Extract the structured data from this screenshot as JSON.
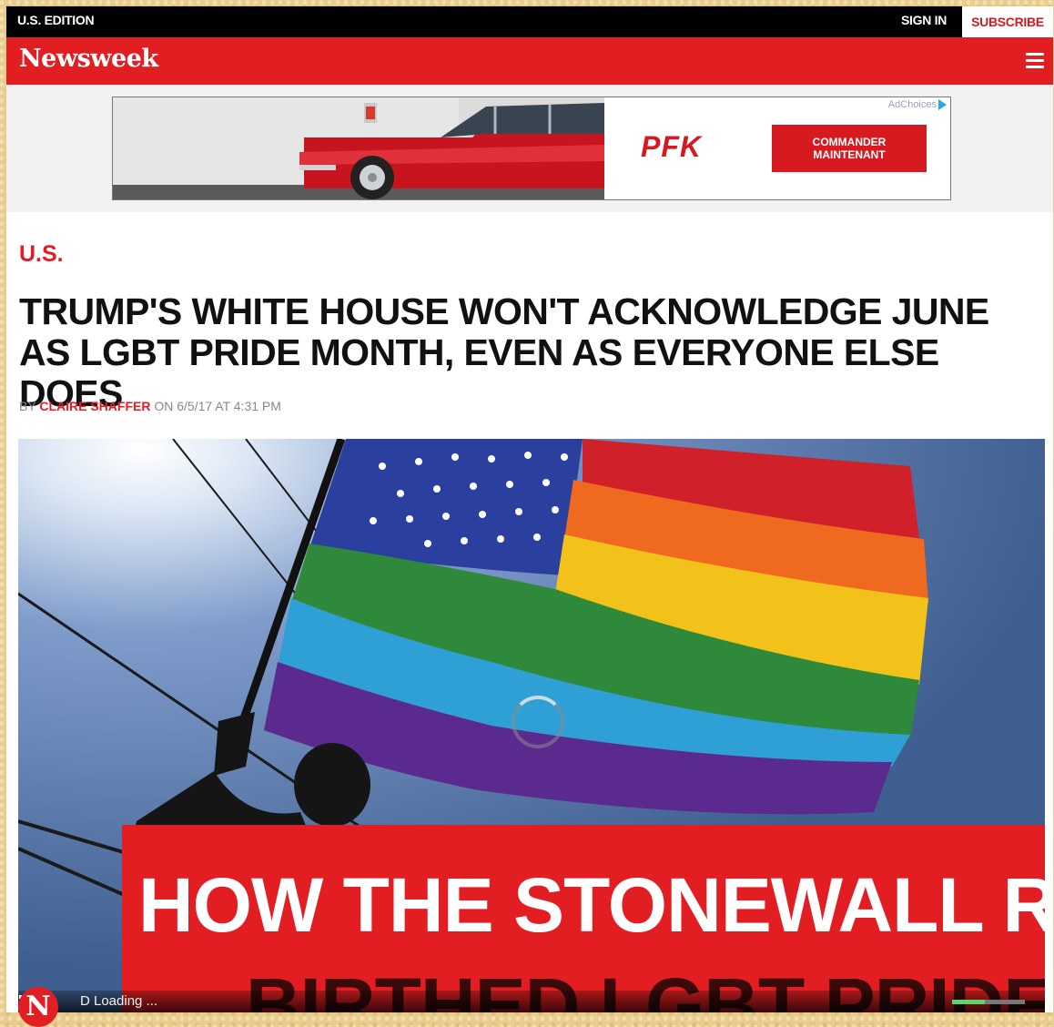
{
  "topbar": {
    "edition": "U.S. EDITION",
    "sign_in": "SIGN IN",
    "subscribe": "SUBSCRIBE"
  },
  "navbar": {
    "logo": "Newsweek",
    "menu_icon": "hamburger-menu-icon"
  },
  "ad": {
    "adchoices": "AdChoices",
    "brand": "PFK",
    "cta": "COMMANDER\nMAINTENANT"
  },
  "article": {
    "section": "U.S.",
    "headline": "TRUMP'S WHITE HOUSE WON'T ACKNOWLEDGE JUNE AS LGBT PRIDE MONTH, EVEN AS EVERYONE ELSE DOES",
    "byline": {
      "prefix": "BY",
      "author": "CLAIRE SHAFFER",
      "date_text": "ON 6/5/17 AT 4:31 PM"
    }
  },
  "video": {
    "banner_line1": "HOW THE STONEWALL R",
    "banner_line2": "BIRTHED LGBT PRIDE",
    "logo_letter": "N",
    "status": "D Loading ...",
    "volume_level": 0.45
  },
  "colors": {
    "brand_red": "#e31e22",
    "topbar": "#000000",
    "volume": "#5fd36b"
  }
}
